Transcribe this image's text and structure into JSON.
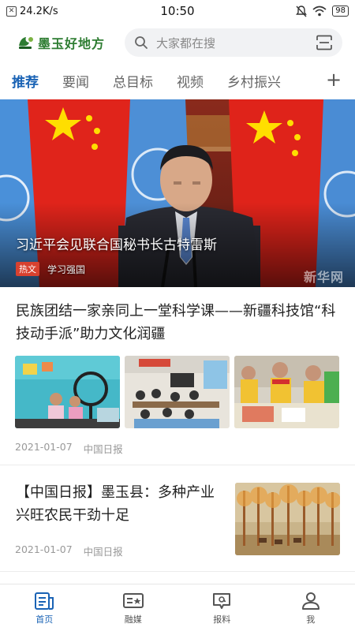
{
  "status_bar": {
    "speed": "24.2K/s",
    "time": "10:50",
    "battery": "98"
  },
  "header": {
    "logo_text": "墨玉好地方",
    "search_placeholder": "大家都在搜"
  },
  "tabs": [
    {
      "label": "推荐",
      "active": true
    },
    {
      "label": "要闻",
      "active": false
    },
    {
      "label": "总目标",
      "active": false
    },
    {
      "label": "视频",
      "active": false
    },
    {
      "label": "乡村振兴",
      "active": false
    }
  ],
  "tab_add": "+",
  "hero": {
    "title": "习近平会见联合国秘书长古特雷斯",
    "tag": "热文",
    "source": "学习强国",
    "watermark": "新华网"
  },
  "articles": [
    {
      "title": "民族团结一家亲同上一堂科学课——新疆科技馆“科技动手派”助力文化润疆",
      "date": "2021-01-07",
      "source": "中国日报"
    },
    {
      "title": "【中国日报】墨玉县：多种产业兴旺农民干劲十足",
      "date": "2021-01-07",
      "source": "中国日报"
    }
  ],
  "bottom_nav": [
    {
      "label": "首页",
      "icon": "home-news-icon",
      "active": true
    },
    {
      "label": "融媒",
      "icon": "media-card-icon",
      "active": false
    },
    {
      "label": "报料",
      "icon": "report-chat-icon",
      "active": false
    },
    {
      "label": "我",
      "icon": "user-icon",
      "active": false
    }
  ],
  "colors": {
    "accent": "#1a63b5",
    "brand_green": "#2e7d32",
    "hot_tag": "#d8412f"
  }
}
